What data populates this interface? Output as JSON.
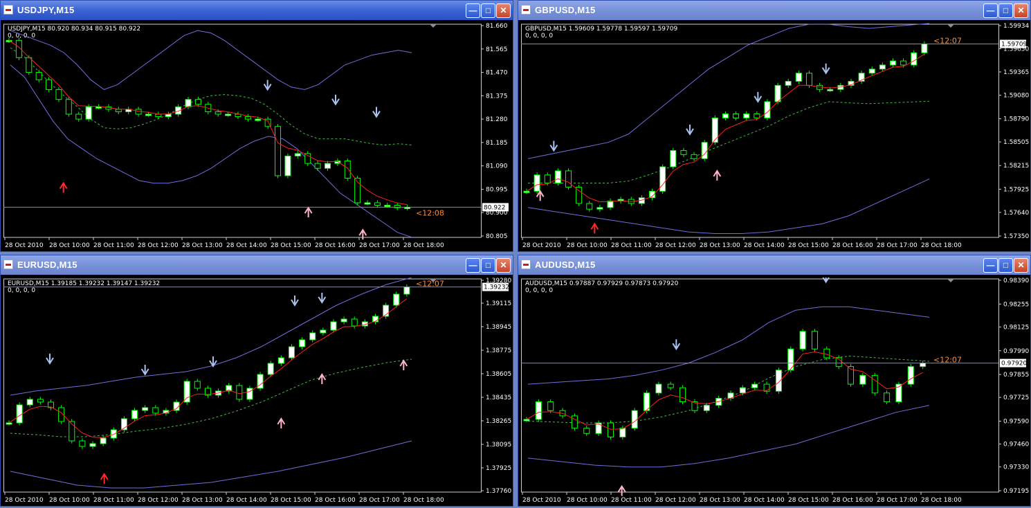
{
  "colors": {
    "bull_body": "#ffffff",
    "bear_body": "#000000",
    "wick": "#00ff00",
    "price_line": "#8c8ca0",
    "label_orange": "#ff8c32"
  },
  "windows": [
    {
      "title": "USDJPY,M15",
      "info_line1": "USDJPY,M15  80.920 80.934 80.915 80.922",
      "info_line2": "0, 0, 0, 0",
      "active": true,
      "price_label": "80.922",
      "time_label": "<12:08",
      "chart_data": {
        "type": "candlestick",
        "y_axis_ticks": [
          "81.660",
          "81.565",
          "81.470",
          "81.375",
          "81.280",
          "81.185",
          "81.090",
          "80.995",
          "80.900",
          "80.805"
        ],
        "ylim": [
          80.805,
          81.66
        ],
        "x_axis_ticks": [
          "28 Oct 2010",
          "28 Oct 10:00",
          "28 Oct 11:00",
          "28 Oct 12:00",
          "28 Oct 13:00",
          "28 Oct 14:00",
          "28 Oct 15:00",
          "28 Oct 16:00",
          "28 Oct 17:00",
          "28 Oct 18:00"
        ],
        "last_price": 80.922,
        "closes": [
          81.6,
          81.53,
          81.47,
          81.44,
          81.4,
          81.36,
          81.3,
          81.28,
          81.33,
          81.33,
          81.32,
          81.31,
          81.32,
          81.3,
          81.3,
          81.29,
          81.3,
          81.33,
          81.36,
          81.34,
          81.31,
          81.3,
          81.3,
          81.29,
          81.28,
          81.28,
          81.25,
          81.05,
          81.13,
          81.14,
          81.1,
          81.08,
          81.1,
          81.11,
          81.04,
          80.94,
          80.94,
          80.93,
          80.93,
          80.92,
          80.922
        ],
        "bands_upper": [
          81.64,
          81.62,
          81.6,
          81.58,
          81.55,
          81.5,
          81.44,
          81.4,
          81.42,
          81.46,
          81.5,
          81.54,
          81.58,
          81.62,
          81.64,
          81.63,
          81.6,
          81.56,
          81.52,
          81.48,
          81.44,
          81.41,
          81.4,
          81.42,
          81.46,
          81.5,
          81.52,
          81.54,
          81.55,
          81.56,
          81.55
        ],
        "bands_lower": [
          81.5,
          81.45,
          81.36,
          81.27,
          81.2,
          81.16,
          81.12,
          81.09,
          81.06,
          81.03,
          81.02,
          81.02,
          81.03,
          81.05,
          81.08,
          81.12,
          81.16,
          81.19,
          81.21,
          81.2,
          81.16,
          81.1,
          81.04,
          80.98,
          80.94,
          80.9,
          80.86,
          80.82,
          80.8
        ],
        "arrows_down": [
          [
            19,
            81.4
          ],
          [
            24,
            81.34
          ],
          [
            27,
            81.29
          ]
        ],
        "arrows_up_red": [
          [
            4,
            81.02
          ]
        ],
        "arrows_up_pink": [
          [
            22,
            80.92
          ],
          [
            26,
            80.83
          ]
        ]
      }
    },
    {
      "title": "GBPUSD,M15",
      "info_line1": "GBPUSD,M15  1.59609 1.59778 1.59597 1.59709",
      "info_line2": "0, 0, 0, 0",
      "active": false,
      "price_label": "1.59709",
      "time_label": "<12:07",
      "chart_data": {
        "type": "candlestick",
        "y_axis_ticks": [
          "1.59934",
          "1.59650",
          "1.59365",
          "1.59080",
          "1.58790",
          "1.58505",
          "1.58215",
          "1.57925",
          "1.57640",
          "1.57350"
        ],
        "ylim": [
          1.5735,
          1.59934
        ],
        "x_axis_ticks": [
          "28 Oct 2010",
          "28 Oct 10:00",
          "28 Oct 11:00",
          "28 Oct 12:00",
          "28 Oct 13:00",
          "28 Oct 14:00",
          "28 Oct 15:00",
          "28 Oct 16:00",
          "28 Oct 17:00",
          "28 Oct 18:00"
        ],
        "last_price": 1.59709,
        "closes": [
          1.579,
          1.581,
          1.58,
          1.5815,
          1.5795,
          1.5775,
          1.5768,
          1.577,
          1.5778,
          1.578,
          1.5775,
          1.5782,
          1.579,
          1.582,
          1.584,
          1.5835,
          1.583,
          1.585,
          1.588,
          1.5885,
          1.588,
          1.5885,
          1.588,
          1.59,
          1.592,
          1.5925,
          1.5935,
          1.592,
          1.5915,
          1.5915,
          1.592,
          1.5925,
          1.5935,
          1.594,
          1.5945,
          1.595,
          1.5945,
          1.596,
          1.5971
        ],
        "bands_upper": [
          1.583,
          1.5835,
          1.584,
          1.5845,
          1.585,
          1.586,
          1.588,
          1.59,
          1.592,
          1.594,
          1.5955,
          1.597,
          1.598,
          1.599,
          1.5995,
          1.5995,
          1.5992,
          1.599,
          1.5992,
          1.5994,
          1.5996
        ],
        "bands_lower": [
          1.577,
          1.5765,
          1.576,
          1.5755,
          1.575,
          1.5745,
          1.574,
          1.5738,
          1.5738,
          1.574,
          1.5745,
          1.575,
          1.576,
          1.5775,
          1.579,
          1.5805
        ],
        "arrows_down": [
          [
            2,
            1.584
          ],
          [
            12,
            1.586
          ],
          [
            17,
            1.59
          ],
          [
            22,
            1.5935
          ]
        ],
        "arrows_up_red": [
          [
            5,
            1.575
          ]
        ],
        "arrows_up_pink": [
          [
            1,
            1.579
          ],
          [
            14,
            1.5815
          ]
        ]
      }
    },
    {
      "title": "EURUSD,M15",
      "info_line1": "EURUSD,M15  1.39185 1.39232 1.39147 1.39232",
      "info_line2": "0, 0, 0, 0",
      "active": false,
      "price_label": "1.39232",
      "time_label": "<12:07",
      "chart_data": {
        "type": "candlestick",
        "y_axis_ticks": [
          "1.39280",
          "1.39115",
          "1.38945",
          "1.38775",
          "1.38605",
          "1.38435",
          "1.38265",
          "1.38095",
          "1.37925",
          "1.37760"
        ],
        "ylim": [
          1.3776,
          1.3928
        ],
        "x_axis_ticks": [
          "28 Oct 2010",
          "28 Oct 10:00",
          "28 Oct 11:00",
          "28 Oct 12:00",
          "28 Oct 13:00",
          "28 Oct 14:00",
          "28 Oct 15:00",
          "28 Oct 16:00",
          "28 Oct 17:00",
          "28 Oct 18:00"
        ],
        "last_price": 1.39232,
        "closes": [
          1.3825,
          1.3838,
          1.3842,
          1.384,
          1.3836,
          1.3826,
          1.3812,
          1.3808,
          1.381,
          1.3814,
          1.382,
          1.3828,
          1.3834,
          1.3836,
          1.3832,
          1.3834,
          1.384,
          1.3855,
          1.385,
          1.3845,
          1.3848,
          1.3852,
          1.3842,
          1.385,
          1.386,
          1.3868,
          1.3872,
          1.388,
          1.3885,
          1.389,
          1.3892,
          1.3898,
          1.39,
          1.3895,
          1.3898,
          1.3902,
          1.391,
          1.3918,
          1.39232
        ],
        "bands_upper": [
          1.3845,
          1.3848,
          1.385,
          1.3852,
          1.3855,
          1.3858,
          1.386,
          1.3862,
          1.3866,
          1.3872,
          1.388,
          1.389,
          1.39,
          1.391,
          1.3918,
          1.3925,
          1.393
        ],
        "bands_lower": [
          1.379,
          1.3785,
          1.378,
          1.3778,
          1.3778,
          1.378,
          1.3782,
          1.3786,
          1.379,
          1.3795,
          1.38,
          1.3806,
          1.3812
        ],
        "arrows_down": [
          [
            3,
            1.3868
          ],
          [
            10,
            1.386
          ],
          [
            15,
            1.3866
          ],
          [
            21,
            1.391
          ],
          [
            23,
            1.3912
          ]
        ],
        "arrows_up_red": [
          [
            7,
            1.3788
          ]
        ],
        "arrows_up_pink": [
          [
            20,
            1.3828
          ],
          [
            23,
            1.386
          ],
          [
            29,
            1.387
          ]
        ]
      }
    },
    {
      "title": "AUDUSD,M15",
      "info_line1": "AUDUSD,M15  0.97887 0.97929 0.97873 0.97920",
      "info_line2": "0, 0, 0, 0",
      "active": false,
      "price_label": "0.97920",
      "time_label": "<12:07",
      "chart_data": {
        "type": "candlestick",
        "y_axis_ticks": [
          "0.98390",
          "0.98255",
          "0.98125",
          "0.97990",
          "0.97855",
          "0.97725",
          "0.97590",
          "0.97460",
          "0.97330",
          "0.97195"
        ],
        "ylim": [
          0.97195,
          0.9839
        ],
        "x_axis_ticks": [
          "28 Oct 2010",
          "28 Oct 10:00",
          "28 Oct 11:00",
          "28 Oct 12:00",
          "28 Oct 13:00",
          "28 Oct 14:00",
          "28 Oct 15:00",
          "28 Oct 16:00",
          "28 Oct 17:00",
          "28 Oct 18:00"
        ],
        "last_price": 0.9792,
        "closes": [
          0.976,
          0.977,
          0.9765,
          0.9762,
          0.9755,
          0.9752,
          0.9758,
          0.975,
          0.9755,
          0.9765,
          0.9775,
          0.978,
          0.9778,
          0.977,
          0.9765,
          0.9768,
          0.9772,
          0.9775,
          0.9778,
          0.978,
          0.9776,
          0.9788,
          0.98,
          0.981,
          0.98,
          0.9795,
          0.979,
          0.978,
          0.9785,
          0.9775,
          0.977,
          0.978,
          0.979,
          0.9792
        ],
        "bands_upper": [
          0.978,
          0.9781,
          0.9782,
          0.9783,
          0.9785,
          0.9788,
          0.9792,
          0.9798,
          0.9805,
          0.9815,
          0.9822,
          0.9824,
          0.9824,
          0.9822,
          0.982,
          0.9818
        ],
        "bands_lower": [
          0.9738,
          0.9736,
          0.9734,
          0.9733,
          0.9733,
          0.9735,
          0.9738,
          0.9742,
          0.9746,
          0.9752,
          0.9758,
          0.9764,
          0.9768
        ],
        "arrows_down": [
          [
            11,
            0.98
          ],
          [
            22,
            0.9838
          ]
        ],
        "arrows_up_red": [],
        "arrows_up_pink": [
          [
            7,
            0.9722
          ]
        ]
      }
    }
  ]
}
